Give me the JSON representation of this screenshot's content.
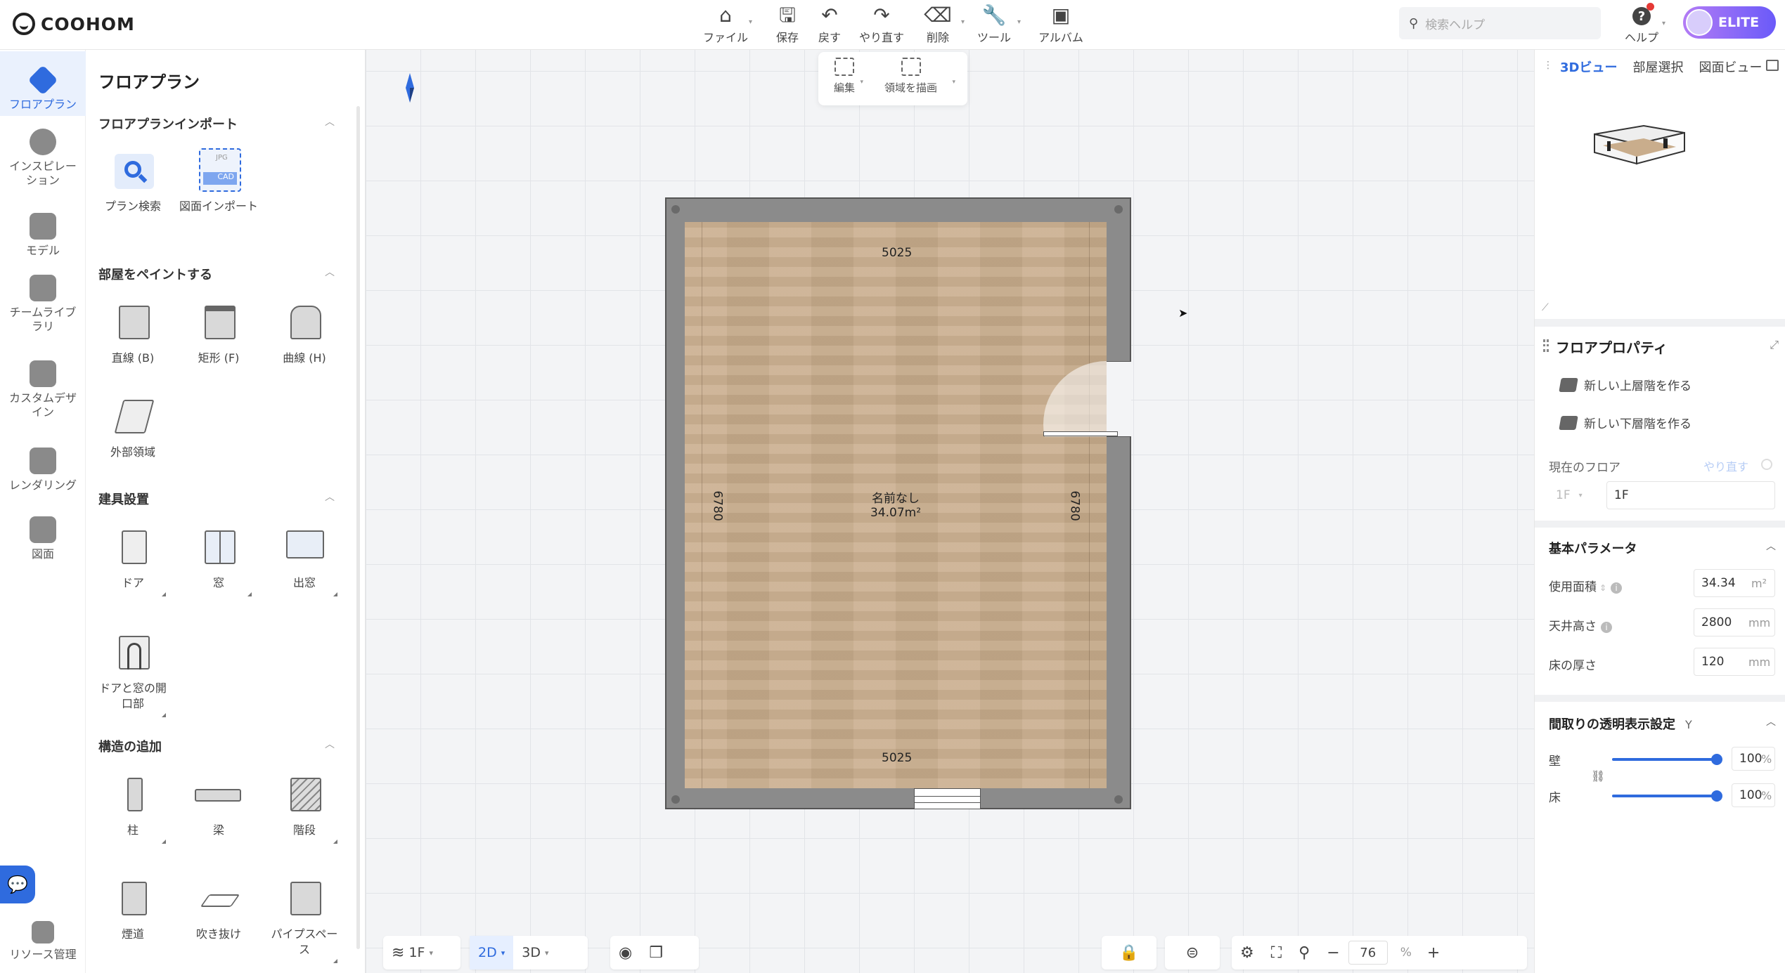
{
  "brand": {
    "name": "COOHOM"
  },
  "toolbar": {
    "items": [
      {
        "label": "ファイル",
        "icon": "home-icon"
      },
      {
        "label": "保存",
        "icon": "save-icon"
      },
      {
        "label": "戻す",
        "icon": "undo-icon"
      },
      {
        "label": "やり直す",
        "icon": "redo-icon"
      },
      {
        "label": "削除",
        "icon": "eraser-icon"
      },
      {
        "label": "ツール",
        "icon": "wrench-icon"
      },
      {
        "label": "アルバム",
        "icon": "album-icon"
      }
    ],
    "search_placeholder": "検索ヘルプ",
    "help_label": "ヘルプ",
    "user_badge": "ELITE"
  },
  "leftnav": {
    "items": [
      {
        "label": "フロアプラン",
        "icon": "floorplan-icon",
        "active": true
      },
      {
        "label": "インスピレーション",
        "icon": "lightbulb-icon"
      },
      {
        "label": "モデル",
        "icon": "sofa-icon"
      },
      {
        "label": "チームライブラリ",
        "icon": "crown-icon"
      },
      {
        "label": "カスタムデザイン",
        "icon": "custom-design-icon"
      },
      {
        "label": "レンダリング",
        "icon": "camera-icon"
      },
      {
        "label": "図面",
        "icon": "drawing-icon"
      }
    ],
    "resource_label": "リソース管理"
  },
  "library": {
    "title": "フロアプラン",
    "sections": [
      {
        "title": "フロアプランインポート",
        "items": [
          "プラン検索",
          "図面インポート"
        ]
      },
      {
        "title": "部屋をペイントする",
        "items": [
          "直線 (B)",
          "矩形 (F)",
          "曲線 (H)",
          "外部領域"
        ]
      },
      {
        "title": "建具設置",
        "items": [
          "ドア",
          "窓",
          "出窓",
          "ドアと窓の開口部"
        ]
      },
      {
        "title": "構造の追加",
        "items": [
          "柱",
          "梁",
          "階段",
          "煙道",
          "吹き抜け",
          "パイプスペース"
        ]
      }
    ],
    "import_badges": {
      "jpg": "JPG",
      "cad": "CAD"
    }
  },
  "subtool": {
    "edit_label": "編集",
    "draw_label": "領域を描画"
  },
  "plan": {
    "top_dim": "5025",
    "bottom_dim": "5025",
    "left_dim": "6780",
    "right_dim": "6780",
    "room_name": "名前なし",
    "room_area": "34.07m²"
  },
  "bottombar": {
    "floor": "1F",
    "mode_2d": "2D",
    "mode_3d": "3D",
    "zoom": "76",
    "zoom_unit": "%"
  },
  "rightpanel": {
    "tabs": [
      "3Dビュー",
      "部屋選択",
      "図面ビュー"
    ],
    "props_title": "フロアプロパティ",
    "new_upper": "新しい上層階を作る",
    "new_lower": "新しい下層階を作る",
    "current_floor_label": "現在のフロア",
    "redo_link": "やり直す",
    "floor_select": "1F",
    "floor_name": "1F",
    "basic_params": "基本パラメータ",
    "area_label": "使用面積",
    "area_value": "34.34",
    "area_unit": "m²",
    "ceiling_label": "天井高さ",
    "ceiling_value": "2800",
    "ceiling_unit": "mm",
    "floor_thick_label": "床の厚さ",
    "floor_thick_value": "120",
    "floor_thick_unit": "mm",
    "transparency_title": "間取りの透明表示設定",
    "transparency_key": "Y",
    "wall_label": "壁",
    "wall_value": "100",
    "floor_label": "床",
    "floor_value": "100",
    "percent": "%"
  }
}
